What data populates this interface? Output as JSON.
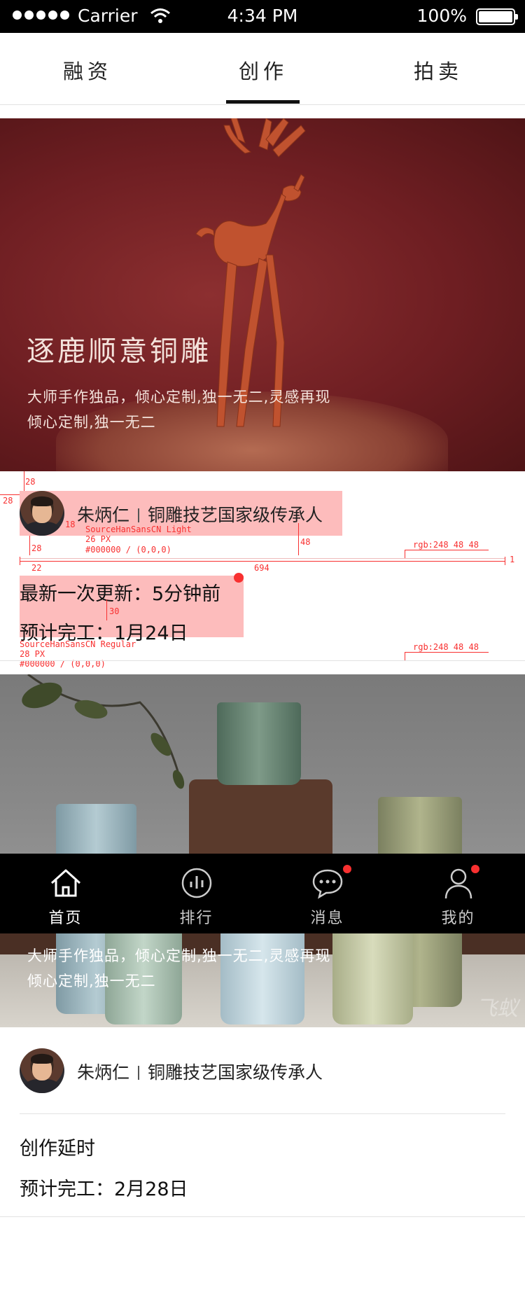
{
  "status_bar": {
    "carrier": "Carrier",
    "time": "4:34 PM",
    "battery": "100%"
  },
  "tabs": [
    {
      "label": "融资"
    },
    {
      "label": "创作",
      "active": true
    },
    {
      "label": "拍卖"
    }
  ],
  "banner1": {
    "title": "逐鹿顺意铜雕",
    "subtitle_line1": "大师手作独品，倾心定制,独一无二,灵感再现",
    "subtitle_line2": "倾心定制,独一无二"
  },
  "card1": {
    "author_name": "朱炳仁",
    "author_title": "铜雕技艺国家级传承人",
    "update_label": "最新一次更新：",
    "update_value": "5分钟前",
    "completion": "预计完工：1月24日"
  },
  "annotations": {
    "m28a": "28",
    "m28b": "28",
    "m18": "18",
    "m28c": "28",
    "m22": "22",
    "m48": "48",
    "m694": "694",
    "m30": "30",
    "m1": "1",
    "spec1": "SourceHanSansCN Light",
    "spec1_size": "26 PX",
    "spec1_color": "#000000 / (0,0,0)",
    "rgb1": "rgb:248 48 48",
    "spec2": "SourceHanSansCN Regular",
    "spec2_size": "28 PX",
    "spec2_color": "#000000 / (0,0,0)",
    "rgb2": "rgb:248 48 48"
  },
  "banner2": {
    "subtitle_line1": "大师手作独品，倾心定制,独一无二,灵感再现",
    "subtitle_line2": "倾心定制,独一无二",
    "watermark": "飞蚁"
  },
  "bottom_nav": [
    {
      "label": "首页",
      "icon": "home-icon"
    },
    {
      "label": "排行",
      "icon": "bar-chart-icon"
    },
    {
      "label": "消息",
      "icon": "chat-bubble-icon",
      "badge": true
    },
    {
      "label": "我的",
      "icon": "person-icon",
      "badge": true
    }
  ],
  "card2": {
    "author_name": "朱炳仁",
    "author_title": "铜雕技艺国家级传承人",
    "status": "创作延时",
    "completion": "预计完工：2月28日"
  },
  "colors": {
    "accent_red": "#f83030",
    "tab_active": "#111111",
    "nav_bg": "#000000"
  }
}
